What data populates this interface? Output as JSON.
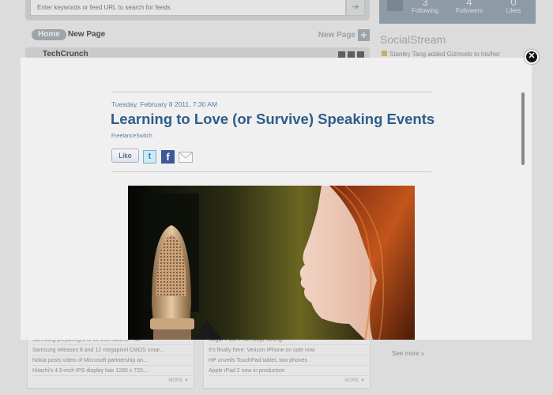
{
  "background": {
    "search": {
      "placeholder": "Enter keywords or feed URL to search for feeds"
    },
    "tabs": {
      "home": "Home",
      "new_page": "New Page",
      "add_page": "New Page"
    },
    "widget": {
      "title": "TechCrunch"
    },
    "profile_stats": [
      {
        "value": "3",
        "label": "Following"
      },
      {
        "value": "4",
        "label": "Followers"
      },
      {
        "value": "0",
        "label": "Likes"
      }
    ],
    "social_stream": {
      "title": "SocialStream",
      "first_item": "Stanley Tang added Gizmodo to his/her",
      "see_more": "See more »"
    },
    "left_feed": [
      "Samsung preparing 8 to 11-inch tablets? No",
      "Samsung releases 8 and 12 megapixel CMOS smar...",
      "Nokia posts video of Microsoft partnership an...",
      "Hitachi's 4.5-inch IPS display has 1280 x 720..."
    ],
    "right_feed": [
      "Sugar Pilot: Fruit Ninja Strong!",
      "It's finally here: Verizon iPhone on sale now",
      "HP unveils TouchPad tablet, two phones",
      "Apple iPad 2 now in production"
    ],
    "more_label": "MORE"
  },
  "article": {
    "date": "Tuesday, February 8 2011, 7:30 AM",
    "title": "Learning to Love (or Survive) Speaking Events",
    "source": "FreelanceSwitch",
    "like_label": "Like"
  },
  "icons": {
    "twitter": "twitter-icon",
    "facebook": "facebook-icon",
    "mail": "mail-icon",
    "close": "close-icon"
  },
  "colors": {
    "title": "#2f5d8a",
    "date": "#5a7da0",
    "facebook": "#3b5998",
    "twitter": "#1f8fc2"
  }
}
